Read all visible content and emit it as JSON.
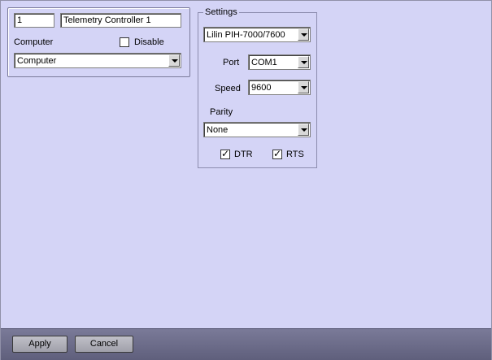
{
  "object": {
    "id_value": "1",
    "name_value": "Telemetry Controller 1",
    "computer_label": "Computer",
    "disable_label": "Disable",
    "disable_checked": false,
    "computer_select": "Computer"
  },
  "settings": {
    "title": "Settings",
    "model_select": "Lilin PIH-7000/7600",
    "port_label": "Port",
    "port_select": "COM1",
    "speed_label": "Speed",
    "speed_select": "9600",
    "parity_label": "Parity",
    "parity_select": "None",
    "dtr_label": "DTR",
    "dtr_checked": true,
    "rts_label": "RTS",
    "rts_checked": true
  },
  "footer": {
    "apply_label": "Apply",
    "cancel_label": "Cancel"
  }
}
